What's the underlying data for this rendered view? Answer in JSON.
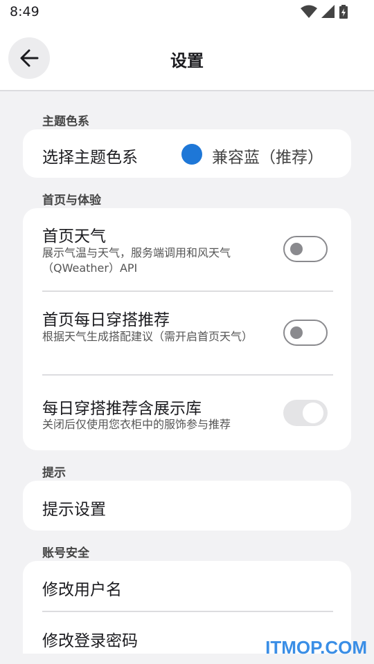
{
  "status_bar": {
    "time": "8:49",
    "icons": [
      "wifi-icon",
      "signal-icon",
      "battery-icon"
    ]
  },
  "app_bar": {
    "back_icon": "arrow-left-icon",
    "title": "设置"
  },
  "sections": {
    "theme": {
      "label": "主题色系",
      "row_title": "选择主题色系",
      "value": "兼容蓝（推荐）",
      "color": "#1e77d7"
    },
    "home": {
      "label": "首页与体验",
      "weather": {
        "title": "首页天气",
        "subtitle": "展示气温与天气，服务端调用和风天气（QWeather）API",
        "enabled": false
      },
      "outfit": {
        "title": "首页每日穿搭推荐",
        "subtitle": "根据天气生成搭配建议（需开启首页天气）",
        "enabled": false
      },
      "showcase": {
        "title": "每日穿搭推荐含展示库",
        "subtitle": "关闭后仅使用您衣柜中的服饰参与推荐",
        "enabled": true
      }
    },
    "tips": {
      "label": "提示",
      "row_title": "提示设置"
    },
    "account": {
      "label": "账号安全",
      "change_username": "修改用户名",
      "change_password": "修改登录密码"
    }
  },
  "watermark": {
    "text": "ITMOP.COM",
    "color": "#3a8ee6"
  }
}
